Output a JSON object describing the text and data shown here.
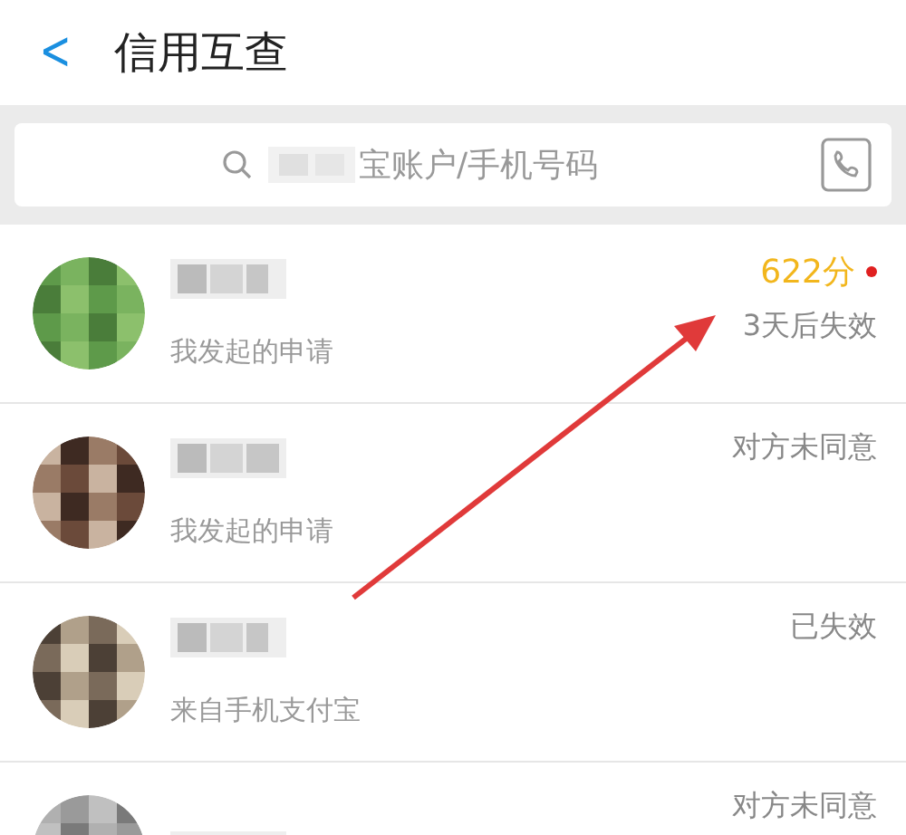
{
  "header": {
    "back": "<",
    "title": "信用互查"
  },
  "search": {
    "placeholder": "宝账户/手机号码"
  },
  "requests": [
    {
      "subtitle": "我发起的申请",
      "score": "622分",
      "unread": true,
      "status": "3天后失效"
    },
    {
      "subtitle": "我发起的申请",
      "unread": false,
      "status": "对方未同意"
    },
    {
      "subtitle": "来自手机支付宝",
      "unread": false,
      "status": "已失效"
    },
    {
      "unread": false,
      "status": "对方未同意"
    }
  ]
}
